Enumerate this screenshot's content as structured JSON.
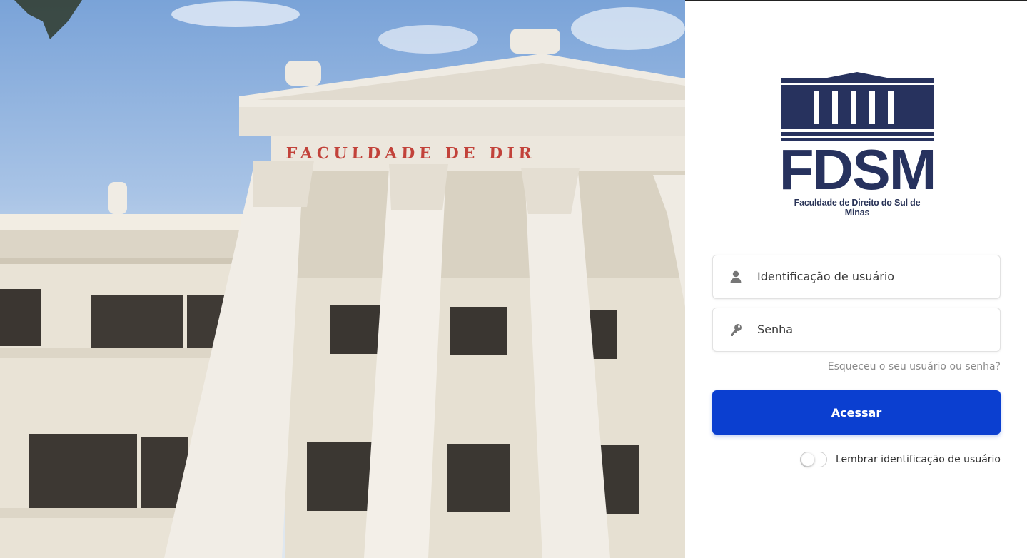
{
  "hero": {
    "building_inscription": "FACULDADE DE DIR"
  },
  "logo": {
    "acronym": "FDSM",
    "full_name": "Faculdade de Direito do Sul de Minas",
    "color": "#27325e"
  },
  "login": {
    "username_placeholder": "Identificação de usuário",
    "username_icon": "user-icon",
    "password_placeholder": "Senha",
    "password_icon": "key-icon",
    "forgot_link": "Esqueceu o seu usuário ou senha?",
    "submit_label": "Acessar",
    "remember_label": "Lembrar identificação de usuário",
    "remember_checked": false
  },
  "colors": {
    "primary": "#0b3fd0",
    "text": "#3a3a3a",
    "muted": "#8a8a8a"
  }
}
